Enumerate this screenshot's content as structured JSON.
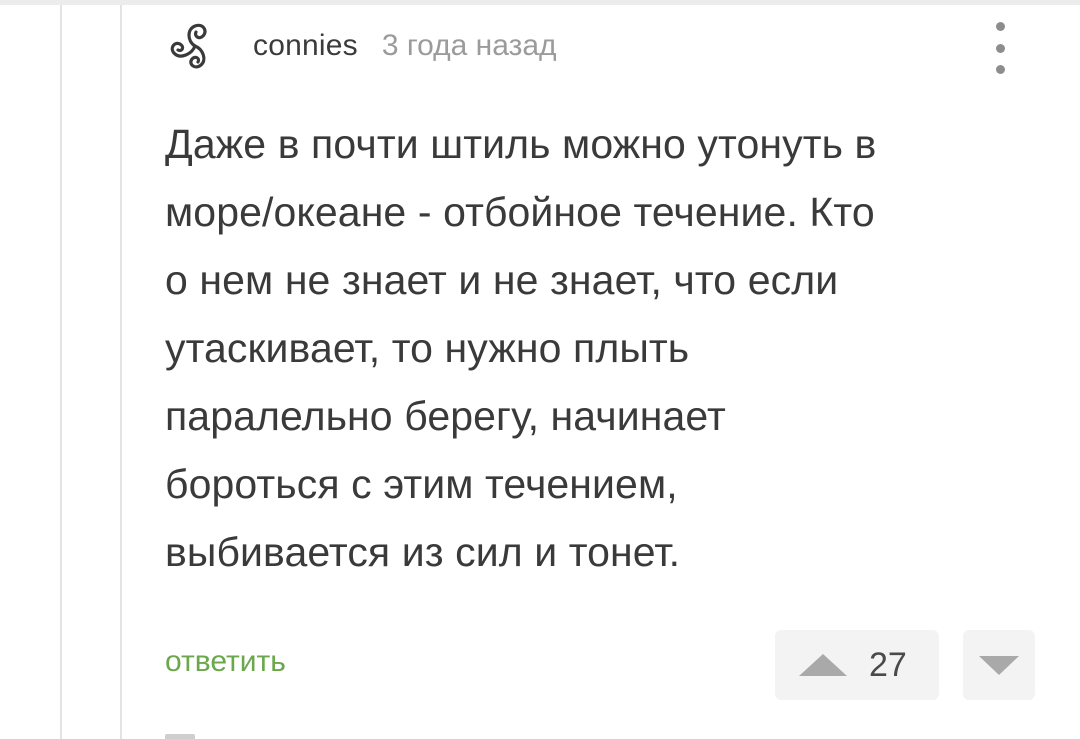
{
  "comment": {
    "username": "connies",
    "timestamp": "3 года назад",
    "avatar_icon": "triskelion-icon",
    "menu_icon": "more-vertical-icon",
    "text": "Даже в почти штиль можно утонуть в\nморе/океане - отбойное течение. Кто\nо нем не знает и не знает, что если\nутаскивает, то нужно плыть\nпаралельно берегу, начинает\nбороться с этим течением,\nвыбивается из сил и тонет.",
    "reply_label": "ответить",
    "votes": {
      "count": "27",
      "upvote_icon": "triangle-up-icon",
      "downvote_icon": "triangle-down-icon"
    }
  },
  "colors": {
    "text": "#3a3a3a",
    "muted": "#9b9b9b",
    "reply_accent": "#6aa74d",
    "vote_bg": "#f3f3f3",
    "vote_icon": "#a9a9a9",
    "thread_line": "#e3e3e3"
  }
}
